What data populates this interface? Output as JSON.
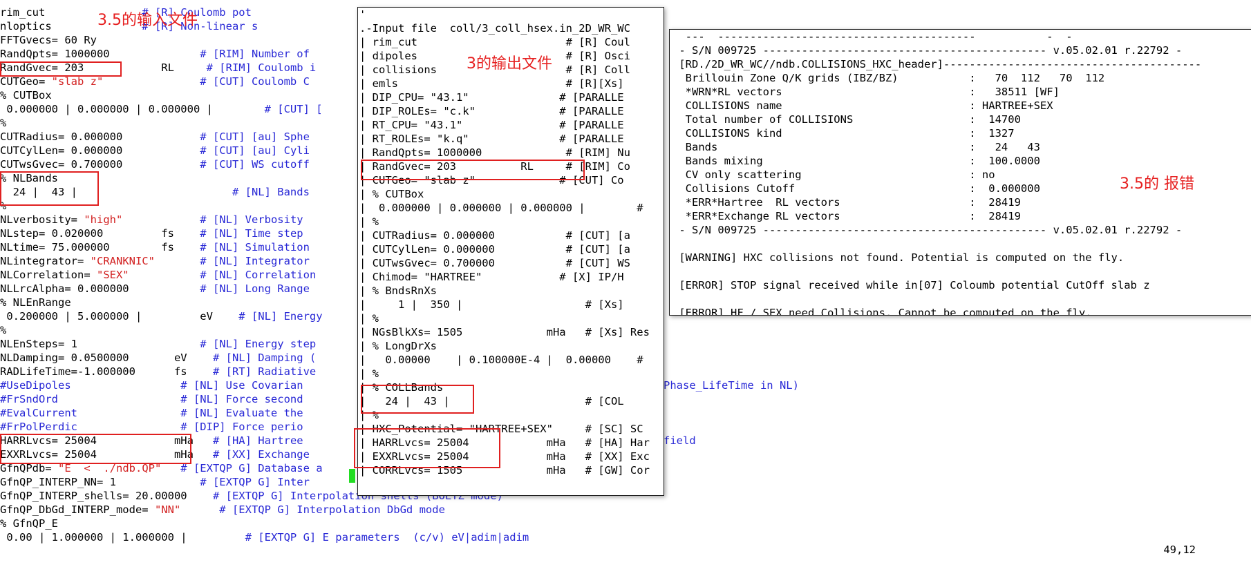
{
  "background_lines": [
    [
      {
        "t": "rim_cut",
        "c": "k"
      },
      {
        "t": "               # [R] Coulomb pot",
        "c": "blue"
      }
    ],
    [
      {
        "t": "nloptics",
        "c": "k"
      },
      {
        "t": "              # [R] Non-linear s",
        "c": "blue"
      }
    ],
    [
      {
        "t": "FFTGvecs= 60 Ry",
        "c": "k"
      }
    ],
    [
      {
        "t": "RandQpts= 1000000",
        "c": "k"
      },
      {
        "t": "              # [RIM] Number of",
        "c": "blue"
      }
    ],
    [
      {
        "t": "RandGvec= 203            RL",
        "c": "k"
      },
      {
        "t": "     # [RIM] Coulomb i",
        "c": "blue"
      }
    ],
    [
      {
        "t": "CUTGeo= ",
        "c": "k"
      },
      {
        "t": "\"slab z\"",
        "c": "red"
      },
      {
        "t": "               # [CUT] Coulomb C",
        "c": "blue"
      }
    ],
    [
      {
        "t": "% CUTBox",
        "c": "k"
      }
    ],
    [
      {
        "t": " 0.000000 | 0.000000 | 0.000000 |",
        "c": "k"
      },
      {
        "t": "        # [CUT] [",
        "c": "blue"
      }
    ],
    [
      {
        "t": "%",
        "c": "k"
      }
    ],
    [
      {
        "t": "CUTRadius= 0.000000",
        "c": "k"
      },
      {
        "t": "            # [CUT] [au] Sphe",
        "c": "blue"
      }
    ],
    [
      {
        "t": "CUTCylLen= 0.000000",
        "c": "k"
      },
      {
        "t": "            # [CUT] [au] Cyli",
        "c": "blue"
      }
    ],
    [
      {
        "t": "CUTwsGvec= 0.700000",
        "c": "k"
      },
      {
        "t": "            # [CUT] WS cutoff",
        "c": "blue"
      }
    ],
    [
      {
        "t": "% NLBands",
        "c": "k"
      }
    ],
    [
      {
        "t": "  24 |  43 |",
        "c": "k"
      },
      {
        "t": "                        # [NL] Bands",
        "c": "blue"
      }
    ],
    [
      {
        "t": "%",
        "c": "k"
      }
    ],
    [
      {
        "t": "NLverbosity= ",
        "c": "k"
      },
      {
        "t": "\"high\"",
        "c": "red"
      },
      {
        "t": "            # [NL] Verbosity",
        "c": "blue"
      }
    ],
    [
      {
        "t": "NLstep= 0.020000         fs",
        "c": "k"
      },
      {
        "t": "    # [NL] Time step",
        "c": "blue"
      }
    ],
    [
      {
        "t": "NLtime= 75.000000        fs",
        "c": "k"
      },
      {
        "t": "    # [NL] Simulation",
        "c": "blue"
      }
    ],
    [
      {
        "t": "NLintegrator= ",
        "c": "k"
      },
      {
        "t": "\"CRANKNIC\"",
        "c": "red"
      },
      {
        "t": "       # [NL] Integrator",
        "c": "blue"
      }
    ],
    [
      {
        "t": "NLCorrelation= ",
        "c": "k"
      },
      {
        "t": "\"SEX\"",
        "c": "red"
      },
      {
        "t": "           # [NL] Correlation",
        "c": "blue"
      }
    ],
    [
      {
        "t": "NLLrcAlpha= 0.000000",
        "c": "k"
      },
      {
        "t": "           # [NL] Long Range",
        "c": "blue"
      }
    ],
    [
      {
        "t": "% NLEnRange",
        "c": "k"
      }
    ],
    [
      {
        "t": " 0.200000 | 5.000000 |         eV",
        "c": "k"
      },
      {
        "t": "    # [NL] Energy",
        "c": "blue"
      }
    ],
    [
      {
        "t": "%",
        "c": "k"
      }
    ],
    [
      {
        "t": "NLEnSteps= 1",
        "c": "k"
      },
      {
        "t": "                   # [NL] Energy step",
        "c": "blue"
      }
    ],
    [
      {
        "t": "NLDamping= 0.0500000       eV",
        "c": "k"
      },
      {
        "t": "    # [NL] Damping (",
        "c": "blue"
      }
    ],
    [
      {
        "t": "RADLifeTime=-1.000000      fs",
        "c": "k"
      },
      {
        "t": "    # [RT] Radiative",
        "c": "blue"
      }
    ],
    [
      {
        "t": "#UseDipoles                 # [NL] Use Covarian",
        "c": "blue"
      }
    ],
    [
      {
        "t": "#FrSndOrd                   # [NL] Force second",
        "c": "blue"
      }
    ],
    [
      {
        "t": "#EvalCurrent                # [NL] Evaluate the",
        "c": "blue"
      }
    ],
    [
      {
        "t": "#FrPolPerdic                # [DIP] Force perio",
        "c": "blue"
      }
    ],
    [
      {
        "t": "HARRLvcs= 25004",
        "c": "k"
      },
      {
        "t": "            mHa",
        "c": "k"
      },
      {
        "t": "   # [HA] Hartree",
        "c": "blue"
      }
    ],
    [
      {
        "t": "EXXRLvcs= 25004",
        "c": "k"
      },
      {
        "t": "            mHa",
        "c": "k"
      },
      {
        "t": "   # [XX] Exchange",
        "c": "blue"
      }
    ],
    [
      {
        "t": "GfnQPdb= ",
        "c": "k"
      },
      {
        "t": "\"E  <  ./ndb.QP\"",
        "c": "red"
      },
      {
        "t": "   # [EXTQP G] Database a",
        "c": "blue"
      }
    ],
    [
      {
        "t": "GfnQP_INTERP_NN= 1",
        "c": "k"
      },
      {
        "t": "             # [EXTQP G] Inter",
        "c": "blue"
      }
    ],
    [
      {
        "t": "GfnQP_INTERP_shells= 20.00000",
        "c": "k"
      },
      {
        "t": "    # [EXTQP G] Interpolation shells (BOLTZ mode)",
        "c": "blue"
      }
    ],
    [
      {
        "t": "GfnQP_DbGd_INTERP_mode= ",
        "c": "k"
      },
      {
        "t": "\"NN\"",
        "c": "red"
      },
      {
        "t": "      # [EXTQP G] Interpolation DbGd mode",
        "c": "blue"
      }
    ],
    [
      {
        "t": "% GfnQP_E",
        "c": "k"
      }
    ],
    [
      {
        "t": " 0.00 | 1.000000 | 1.000000 |",
        "c": "k"
      },
      {
        "t": "         # [EXTQP G] E parameters  (c/v) eV|adim|adim",
        "c": "blue"
      }
    ]
  ],
  "background_right_fragments": [
    {
      "text": "Phase_LifeTime in NL)",
      "row": 27
    },
    {
      "text": "field",
      "row": 31
    }
  ],
  "middle_lines": [
    [
      {
        "t": "'",
        "c": "k"
      }
    ],
    [
      {
        "t": ".-Input file  coll/3_coll_hsex.in_2D_WR_WC",
        "c": "k"
      }
    ],
    [
      {
        "t": "| rim_cut                       ",
        "c": "k"
      },
      {
        "t": "# [R] Coul",
        "c": "k"
      }
    ],
    [
      {
        "t": "| dipoles                       ",
        "c": "k"
      },
      {
        "t": "# [R] Osci",
        "c": "k"
      }
    ],
    [
      {
        "t": "| collisions                    ",
        "c": "k"
      },
      {
        "t": "# [R] Coll",
        "c": "k"
      }
    ],
    [
      {
        "t": "| emls                          ",
        "c": "k"
      },
      {
        "t": "# [R][Xs]",
        "c": "k"
      }
    ],
    [
      {
        "t": "| DIP_CPU= \"43.1\"              ",
        "c": "k"
      },
      {
        "t": "# [PARALLE",
        "c": "k"
      }
    ],
    [
      {
        "t": "| DIP_ROLEs= \"c.k\"             ",
        "c": "k"
      },
      {
        "t": "# [PARALLE",
        "c": "k"
      }
    ],
    [
      {
        "t": "| RT_CPU= \"43.1\"               ",
        "c": "k"
      },
      {
        "t": "# [PARALLE",
        "c": "k"
      }
    ],
    [
      {
        "t": "| RT_ROLEs= \"k.q\"              ",
        "c": "k"
      },
      {
        "t": "# [PARALLE",
        "c": "k"
      }
    ],
    [
      {
        "t": "| RandQpts= 1000000             ",
        "c": "k"
      },
      {
        "t": "# [RIM] Nu",
        "c": "k"
      }
    ],
    [
      {
        "t": "| RandGvec= 203          RL     ",
        "c": "k"
      },
      {
        "t": "# [RIM] Co",
        "c": "k"
      }
    ],
    [
      {
        "t": "| CUTGeo= \"slab z\"             ",
        "c": "k"
      },
      {
        "t": "# [CUT] Co",
        "c": "k"
      }
    ],
    [
      {
        "t": "| % CUTBox",
        "c": "k"
      }
    ],
    [
      {
        "t": "|  0.000000 | 0.000000 | 0.000000 |        #",
        "c": "k"
      }
    ],
    [
      {
        "t": "| %",
        "c": "k"
      }
    ],
    [
      {
        "t": "| CUTRadius= 0.000000           ",
        "c": "k"
      },
      {
        "t": "# [CUT] [a",
        "c": "k"
      }
    ],
    [
      {
        "t": "| CUTCylLen= 0.000000           ",
        "c": "k"
      },
      {
        "t": "# [CUT] [a",
        "c": "k"
      }
    ],
    [
      {
        "t": "| CUTwsGvec= 0.700000           ",
        "c": "k"
      },
      {
        "t": "# [CUT] WS",
        "c": "k"
      }
    ],
    [
      {
        "t": "| Chimod= \"HARTREE\"            ",
        "c": "k"
      },
      {
        "t": "# [X] IP/H",
        "c": "k"
      }
    ],
    [
      {
        "t": "| % BndsRnXs",
        "c": "k"
      }
    ],
    [
      {
        "t": "|     1 |  350 |                   # [Xs]",
        "c": "k"
      }
    ],
    [
      {
        "t": "| %",
        "c": "k"
      }
    ],
    [
      {
        "t": "| NGsBlkXs= 1505             mHa   # [Xs] Res",
        "c": "k"
      }
    ],
    [
      {
        "t": "| % LongDrXs",
        "c": "k"
      }
    ],
    [
      {
        "t": "|   0.00000    | 0.100000E-4 |  0.00000    #",
        "c": "k"
      }
    ],
    [
      {
        "t": "| %",
        "c": "k"
      }
    ],
    [
      {
        "t": "| % COLLBands",
        "c": "k"
      }
    ],
    [
      {
        "t": "|   24 |  43 |                     # [COL",
        "c": "k"
      }
    ],
    [
      {
        "t": "| %",
        "c": "k"
      }
    ],
    [
      {
        "t": "| HXC_Potential= \"HARTREE+SEX\"     # [SC] SC",
        "c": "k"
      }
    ],
    [
      {
        "t": "| HARRLvcs= 25004            mHa   # [HA] Har",
        "c": "k"
      }
    ],
    [
      {
        "t": "| EXXRLvcs= 25004            mHa   # [XX] Exc",
        "c": "k"
      }
    ],
    [
      {
        "t": "| CORRLvcs= 1505             mHa   # [GW] Cor",
        "c": "k"
      }
    ]
  ],
  "right_lines": [
    [
      {
        "t": "  ---  ----------------------------------------           -  -",
        "c": "k"
      }
    ],
    [
      {
        "t": " - S/N 009725 -------------------------------------------- v.05.02.01 r.22792 -",
        "c": "k"
      }
    ],
    [
      {
        "t": " [RD./2D_WR_WC//ndb.COLLISIONS_HXC_header]----------------------------------------",
        "c": "k"
      }
    ],
    [
      {
        "t": "  Brillouin Zone Q/K grids (IBZ/BZ)           :   70  112   70  112",
        "c": "k"
      }
    ],
    [
      {
        "t": "  *WRN*RL vectors                             :   38511 [WF]",
        "c": "k"
      }
    ],
    [
      {
        "t": "  COLLISIONS name                             : HARTREE+SEX",
        "c": "k"
      }
    ],
    [
      {
        "t": "  Total number of COLLISIONS                  :  14700",
        "c": "k"
      }
    ],
    [
      {
        "t": "  COLLISIONS kind                             :  1327",
        "c": "k"
      }
    ],
    [
      {
        "t": "  Bands                                       :   24   43",
        "c": "k"
      }
    ],
    [
      {
        "t": "  Bands mixing                                :  100.0000",
        "c": "k"
      }
    ],
    [
      {
        "t": "  CV only scattering                          : no",
        "c": "k"
      }
    ],
    [
      {
        "t": "  Collisions Cutoff                           :  0.000000",
        "c": "k"
      }
    ],
    [
      {
        "t": "  *ERR*Hartree  RL vectors                    :  28419",
        "c": "k"
      }
    ],
    [
      {
        "t": "  *ERR*Exchange RL vectors                    :  28419",
        "c": "k"
      }
    ],
    [
      {
        "t": " - S/N 009725 -------------------------------------------- v.05.02.01 r.22792 -",
        "c": "k"
      }
    ],
    [
      {
        "t": "",
        "c": "k"
      }
    ],
    [
      {
        "t": " [WARNING] HXC collisions not found. Potential is computed on the fly.",
        "c": "k"
      }
    ],
    [
      {
        "t": "",
        "c": "k"
      }
    ],
    [
      {
        "t": " [ERROR] STOP signal received while in[07] Coloumb potential CutOff slab z",
        "c": "k"
      }
    ],
    [
      {
        "t": "",
        "c": "k"
      }
    ],
    [
      {
        "t": " [ERROR] HF / SEX need Collisions. Cannot be computed on the fly.",
        "c": "k"
      }
    ]
  ],
  "annotations": {
    "input_label": "3.5的输入文件",
    "output_label": "3的输出文件",
    "error_label": "3.5的 报错"
  },
  "status": {
    "cursor_pos": "49,12"
  },
  "colors": {
    "comment_blue": "#2828d6",
    "string_red": "#d22020",
    "highlight_red": "#e02020",
    "cursor_green": "#22dd22"
  }
}
